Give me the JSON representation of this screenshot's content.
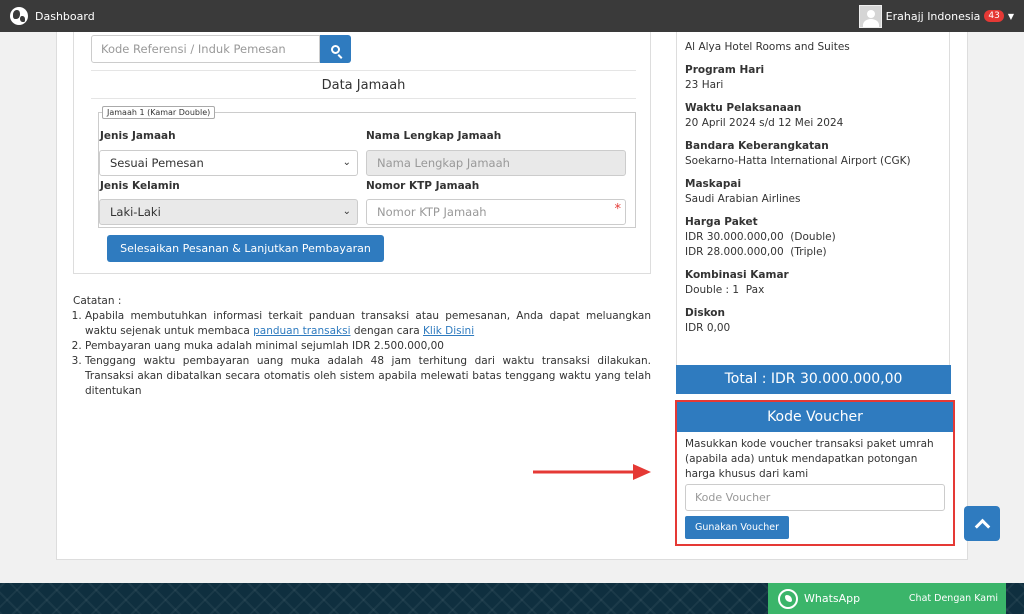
{
  "topbar": {
    "title": "Dashboard",
    "user_name": "Erahajj Indonesia",
    "notification_count": "43"
  },
  "form": {
    "search_placeholder": "Kode Referensi / Induk Pemesan",
    "section_title": "Data Jamaah",
    "fieldset_legend": "Jamaah 1 (Kamar Double)",
    "jenis_jamaah_label": "Jenis Jamaah",
    "jenis_jamaah_value": "Sesuai Pemesan",
    "nama_label": "Nama Lengkap Jamaah",
    "nama_placeholder": "Nama Lengkap Jamaah",
    "jenis_kelamin_label": "Jenis Kelamin",
    "jenis_kelamin_value": "Laki-Laki",
    "ktp_label": "Nomor KTP Jamaah",
    "ktp_placeholder": "Nomor KTP Jamaah",
    "required_mark": "*",
    "submit_label": "Selesaikan Pesanan & Lanjutkan Pembayaran"
  },
  "notes": {
    "title": "Catatan :",
    "item1_prefix": "Apabila membutuhkan informasi terkait panduan transaksi atau pemesanan, Anda dapat meluangkan waktu sejenak untuk membaca ",
    "item1_link1": "panduan transaksi",
    "item1_middle": " dengan cara ",
    "item1_link2": "Klik Disini",
    "item2": "Pembayaran uang muka adalah minimal sejumlah IDR 2.500.000,00",
    "item3": "Tenggang waktu pembayaran uang muka adalah 48 jam terhitung dari waktu transaksi dilakukan. Transaksi akan dibatalkan secara otomatis oleh sistem apabila melewati batas tenggang waktu yang telah ditentukan"
  },
  "summary": {
    "hotel": "Al Alya Hotel Rooms and Suites",
    "program_label": "Program Hari",
    "program_value": "23 Hari",
    "waktu_label": "Waktu Pelaksanaan",
    "waktu_value": "20 April 2024 s/d 12 Mei 2024",
    "bandara_label": "Bandara Keberangkatan",
    "bandara_value": "Soekarno-Hatta International Airport (CGK)",
    "maskapai_label": "Maskapai",
    "maskapai_value": "Saudi Arabian Airlines",
    "harga_label": "Harga Paket",
    "harga_double": "IDR 30.000.000,00  (Double)",
    "harga_triple": "IDR 28.000.000,00  (Triple)",
    "kombinasi_label": "Kombinasi Kamar",
    "kombinasi_value": "Double : 1  Pax",
    "diskon_label": "Diskon",
    "diskon_value": "IDR 0,00",
    "total": "Total : IDR 30.000.000,00"
  },
  "voucher": {
    "title": "Kode Voucher",
    "description": "Masukkan kode voucher transaksi paket umrah (apabila ada) untuk mendapatkan potongan harga khusus dari kami",
    "placeholder": "Kode Voucher",
    "button_label": "Gunakan Voucher"
  },
  "footer": {
    "whatsapp_label": "WhatsApp",
    "chat_label": "Chat Dengan Kami"
  },
  "colors": {
    "primary": "#2f7bbf",
    "highlight": "#e53935",
    "whatsapp": "#3bb56a",
    "topbar": "#3a3a3a"
  }
}
